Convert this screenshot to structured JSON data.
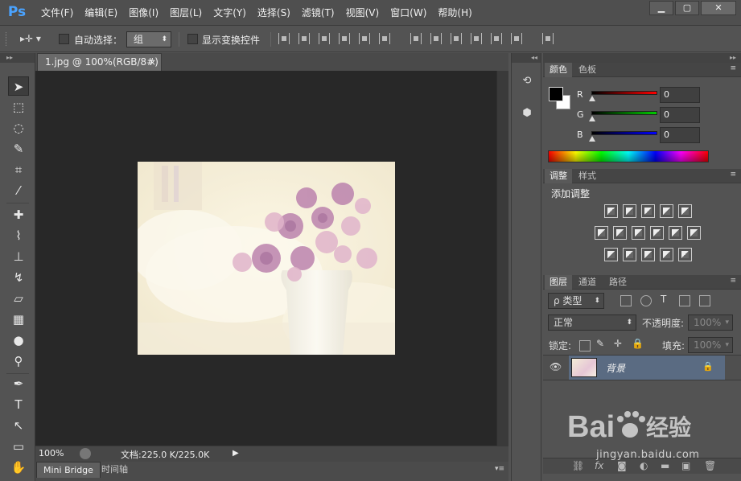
{
  "app": {
    "logo": "Ps",
    "menu": [
      "文件(F)",
      "编辑(E)",
      "图像(I)",
      "图层(L)",
      "文字(Y)",
      "选择(S)",
      "滤镜(T)",
      "视图(V)",
      "窗口(W)",
      "帮助(H)"
    ],
    "window_buttons": {
      "minimize": "▁",
      "maximize": "▢",
      "close": "✕"
    }
  },
  "options": {
    "auto_select_label": "自动选择：",
    "auto_select_value": "组",
    "show_transform_label": "显示变换控件"
  },
  "document": {
    "tab_title": "1.jpg @ 100%(RGB/8#)",
    "tab_close": "×",
    "zoom": "100%",
    "doc_info": "文档:225.0 K/225.0K"
  },
  "bottom_tabs": [
    "Mini Bridge",
    "时间轴"
  ],
  "color_panel": {
    "tabs": [
      "颜色",
      "色板"
    ],
    "channels": [
      {
        "label": "R",
        "value": "0",
        "color": "#ff0000"
      },
      {
        "label": "G",
        "value": "0",
        "color": "#00cc00"
      },
      {
        "label": "B",
        "value": "0",
        "color": "#0000ff"
      }
    ]
  },
  "adjustments_panel": {
    "tabs": [
      "调整",
      "样式"
    ],
    "title": "添加调整"
  },
  "layers_panel": {
    "tabs": [
      "图层",
      "通道",
      "路径"
    ],
    "filter_kind": "ρ 类型",
    "blend_mode": "正常",
    "opacity_label": "不透明度:",
    "opacity_value": "100%",
    "lock_label": "锁定:",
    "fill_label": "填充:",
    "fill_value": "100%",
    "layers": [
      {
        "name": "背景",
        "visible": true,
        "locked": true
      }
    ],
    "footer_icons": [
      "link-icon",
      "fx-icon",
      "mask-icon",
      "adjustment-icon",
      "folder-icon",
      "new-layer-icon",
      "trash-icon"
    ]
  },
  "watermark": {
    "brand_text": "Bai",
    "brand_suffix": "经验",
    "url": "jingyan.baidu.com"
  },
  "colors": {
    "accent_logo": "#4aa3ff",
    "selected_layer": "#5a6b82",
    "canvas_bg": "#282828"
  }
}
